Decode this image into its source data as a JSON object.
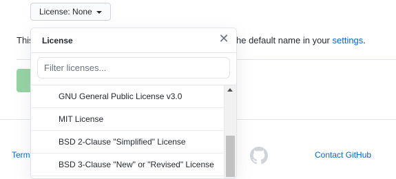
{
  "license_button": {
    "label": "License: None",
    "icon": "triangle-down-icon"
  },
  "background": {
    "line_start": "This",
    "line_end": "he default name in your ",
    "settings_link": "settings",
    "trailing": "."
  },
  "footer": {
    "left_link": "Term",
    "right_link": "Contact GitHub",
    "logo_icon": "github-logo-icon"
  },
  "dropdown": {
    "title": "License",
    "close_icon": "close-icon",
    "filter_placeholder": "Filter licenses...",
    "items": [
      "GNU General Public License v3.0",
      "MIT License",
      "BSD 2-Clause \"Simplified\" License",
      "BSD 3-Clause \"New\" or \"Revised\" License"
    ]
  },
  "colors": {
    "link": "#0366d6",
    "create_button": "#94d3a2"
  }
}
